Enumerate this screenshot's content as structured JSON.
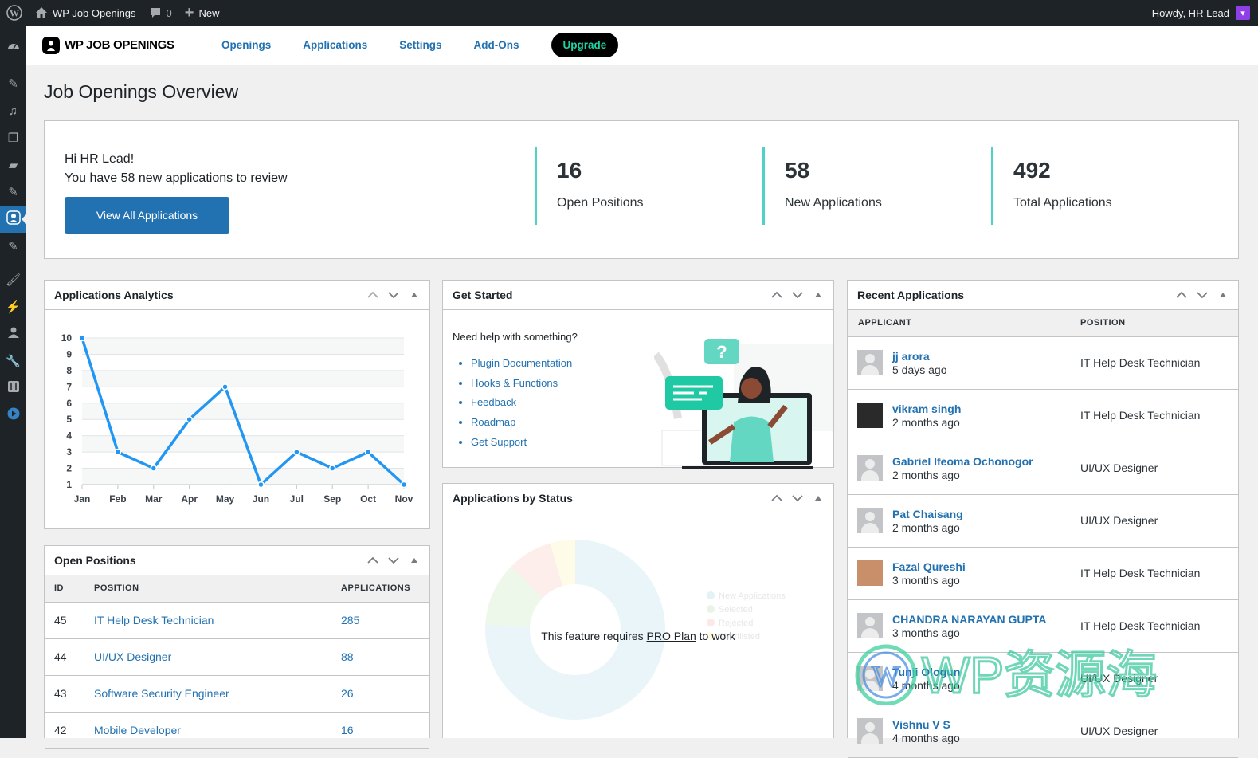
{
  "adminbar": {
    "site_name": "WP Job Openings",
    "comments_count": "0",
    "new_label": "New",
    "howdy": "Howdy, HR Lead"
  },
  "sidebar": {
    "items": [
      {
        "icon": "dashboard-icon"
      },
      {
        "icon": "pin-icon"
      },
      {
        "icon": "media-icon"
      },
      {
        "icon": "pages-icon"
      },
      {
        "icon": "comments-icon"
      },
      {
        "icon": "pin-icon"
      },
      {
        "icon": "job-openings-icon",
        "active": true
      },
      {
        "icon": "pin-icon"
      },
      {
        "icon": "appearance-icon"
      },
      {
        "icon": "plugins-icon"
      },
      {
        "icon": "users-icon"
      },
      {
        "icon": "tools-icon"
      },
      {
        "icon": "settings-icon"
      },
      {
        "icon": "play-icon"
      }
    ]
  },
  "plugin_nav": {
    "brand": "WP JOB OPENINGS",
    "links": [
      "Openings",
      "Applications",
      "Settings",
      "Add-Ons"
    ],
    "upgrade": "Upgrade"
  },
  "page_title": "Job Openings Overview",
  "welcome": {
    "greeting": "Hi HR Lead!",
    "message": "You have 58 new applications to review",
    "button": "View All Applications",
    "stats": [
      {
        "value": "16",
        "label": "Open Positions"
      },
      {
        "value": "58",
        "label": "New Applications"
      },
      {
        "value": "492",
        "label": "Total Applications"
      }
    ],
    "accent": "#4fd1c5"
  },
  "analytics": {
    "title": "Applications Analytics"
  },
  "chart_data": {
    "type": "line",
    "title": "Applications Analytics",
    "categories": [
      "Jan",
      "Feb",
      "Mar",
      "Apr",
      "May",
      "Jun",
      "Jul",
      "Sep",
      "Oct",
      "Nov"
    ],
    "values": [
      10,
      3,
      2,
      5,
      7,
      1,
      3,
      2,
      3,
      1
    ],
    "xlabel": "",
    "ylabel": "",
    "ylim": [
      1,
      10
    ],
    "yticks": [
      1,
      2,
      3,
      4,
      5,
      6,
      7,
      8,
      9,
      10
    ],
    "grid": true,
    "color": "#2196f3"
  },
  "get_started": {
    "title": "Get Started",
    "prompt": "Need help with something?",
    "links": [
      "Plugin Documentation",
      "Hooks & Functions",
      "Feedback",
      "Roadmap",
      "Get Support"
    ]
  },
  "status": {
    "title": "Applications by Status",
    "message_pre": "This feature requires ",
    "message_link": "PRO Plan",
    "message_post": " to work",
    "placeholder_slices": [
      {
        "label": "New Applications",
        "percent": 75.9,
        "color": "#d7ecf2"
      },
      {
        "label": "Selected",
        "percent": 11.5,
        "color": "#dff0d8"
      },
      {
        "label": "Rejected",
        "percent": 8.1,
        "color": "#fbe0dc"
      },
      {
        "label": "Shortlisted",
        "percent": 4.5,
        "color": "#fdf8d5"
      }
    ]
  },
  "open_positions": {
    "title": "Open Positions",
    "columns": [
      "ID",
      "POSITION",
      "APPLICATIONS"
    ],
    "rows": [
      {
        "id": "45",
        "position": "IT Help Desk Technician",
        "applications": "285"
      },
      {
        "id": "44",
        "position": "UI/UX Designer",
        "applications": "88"
      },
      {
        "id": "43",
        "position": "Software Security Engineer",
        "applications": "26"
      },
      {
        "id": "42",
        "position": "Mobile Developer",
        "applications": "16"
      }
    ]
  },
  "recent_applications": {
    "title": "Recent Applications",
    "columns": [
      "APPLICANT",
      "POSITION"
    ],
    "rows": [
      {
        "name": "jj arora",
        "time": "5 days ago",
        "position": "IT Help Desk Technician",
        "avatar": "default"
      },
      {
        "name": "vikram singh",
        "time": "2 months ago",
        "position": "IT Help Desk Technician",
        "avatar": "photo1"
      },
      {
        "name": "Gabriel Ifeoma Ochonogor",
        "time": "2 months ago",
        "position": "UI/UX Designer",
        "avatar": "default"
      },
      {
        "name": "Pat Chaisang",
        "time": "2 months ago",
        "position": "UI/UX Designer",
        "avatar": "default"
      },
      {
        "name": "Fazal Qureshi",
        "time": "3 months ago",
        "position": "IT Help Desk Technician",
        "avatar": "photo2"
      },
      {
        "name": "CHANDRA NARAYAN GUPTA",
        "time": "3 months ago",
        "position": "IT Help Desk Technician",
        "avatar": "default"
      },
      {
        "name": "Tunji Ologun",
        "time": "4 months ago",
        "position": "UI/UX Designer",
        "avatar": "default"
      },
      {
        "name": "Vishnu V S",
        "time": "4 months ago",
        "position": "UI/UX Designer",
        "avatar": "default"
      }
    ]
  },
  "watermark": {
    "text": "WP资源海"
  }
}
